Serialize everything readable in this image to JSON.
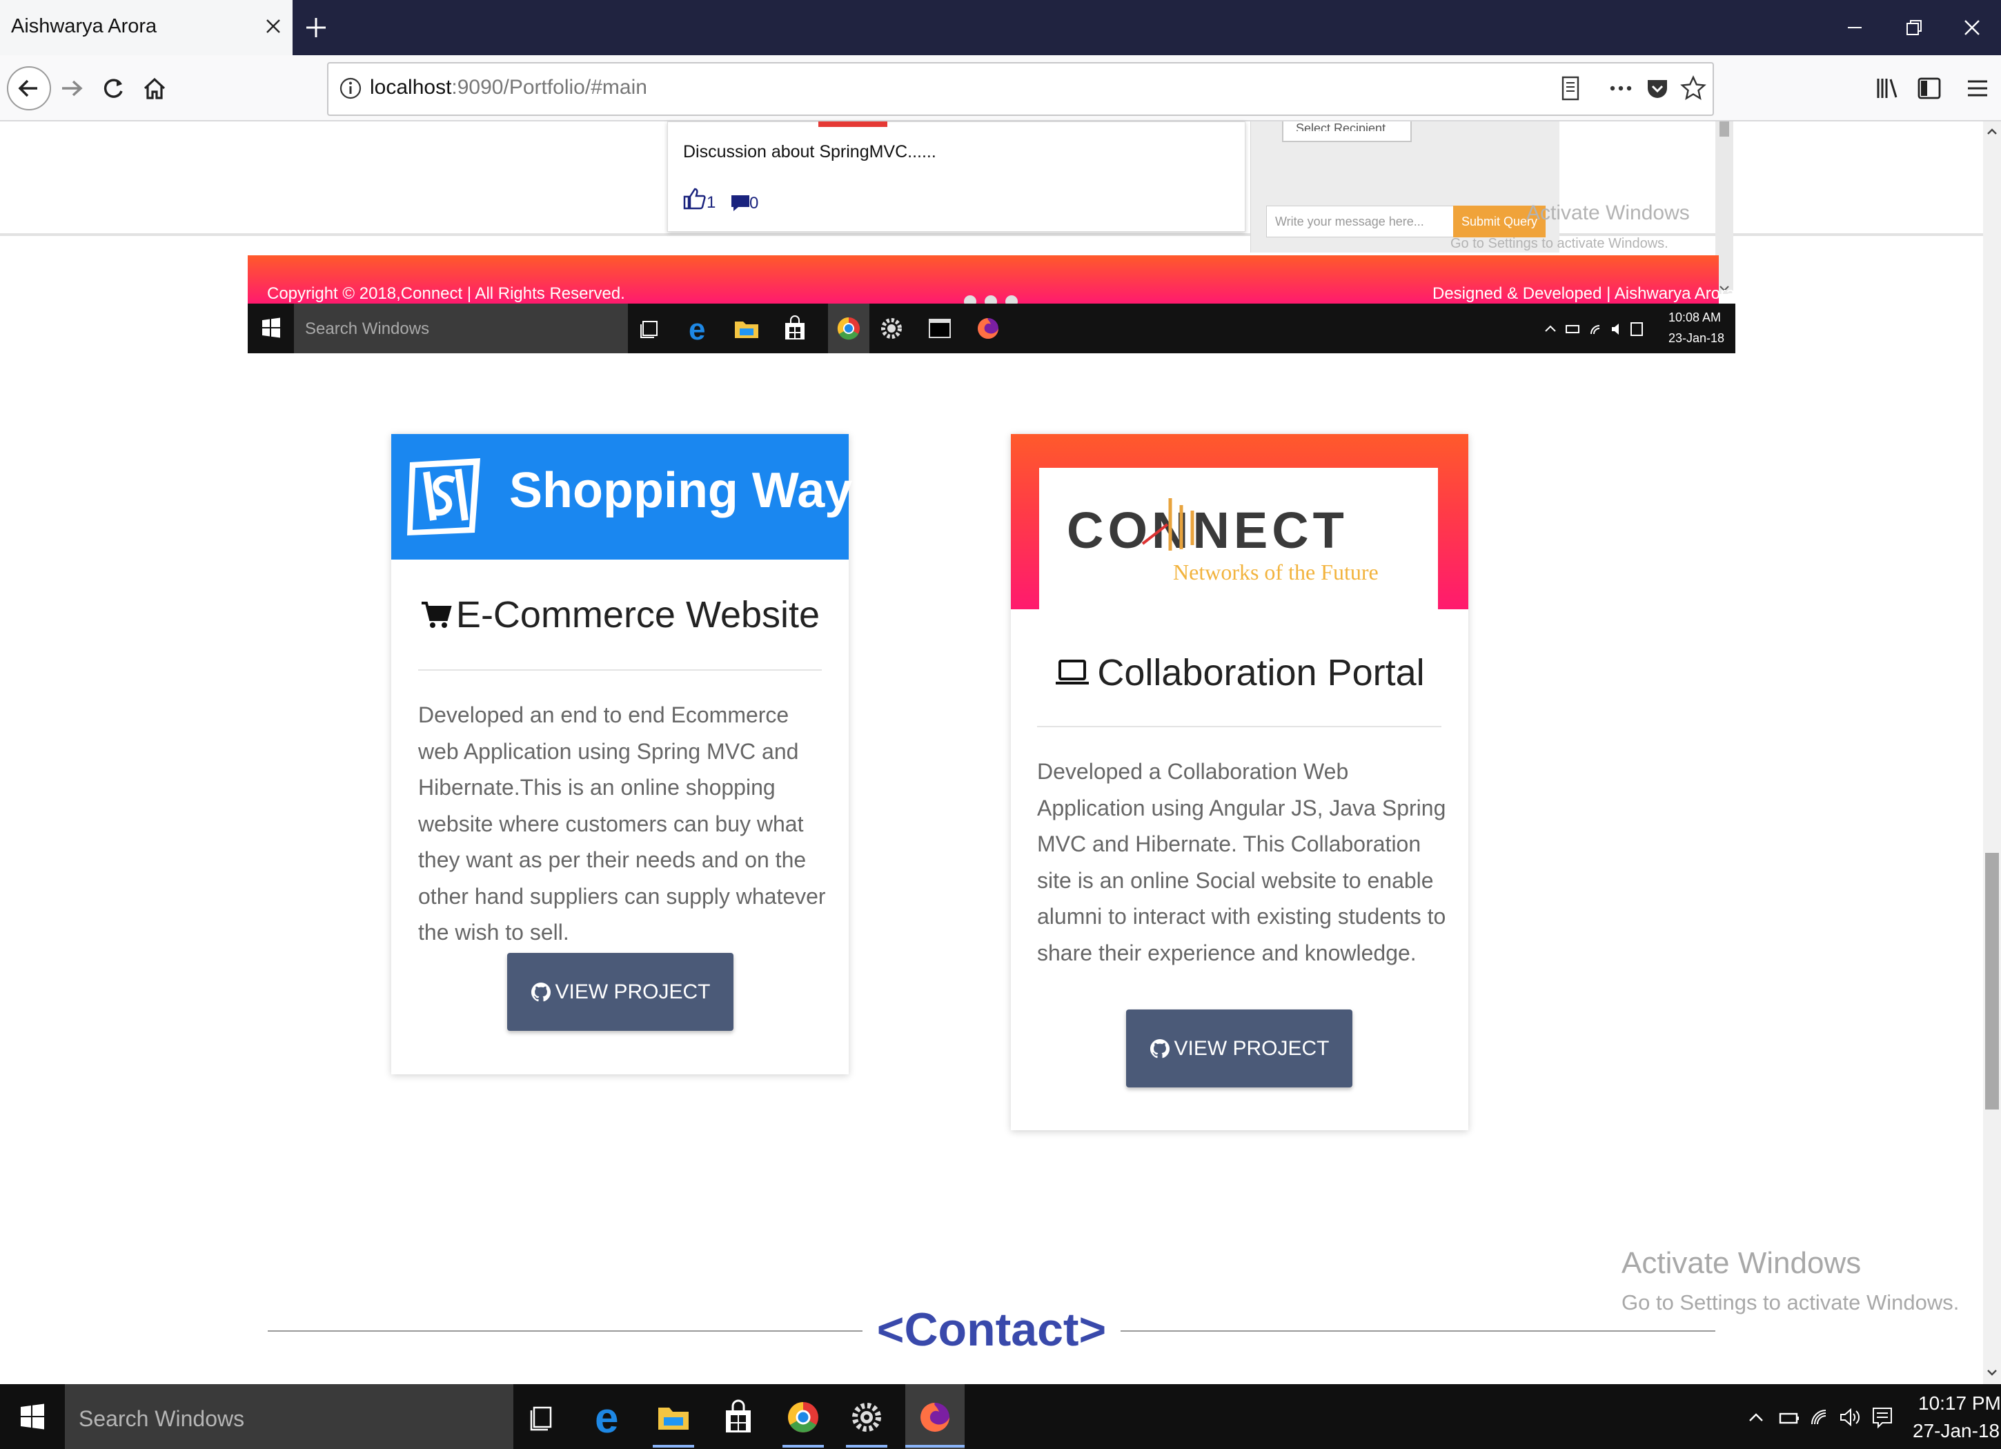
{
  "browser": {
    "tab_title": "Aishwarya Arora",
    "url_host": "localhost",
    "url_rest": ":9090/Portfolio/#main"
  },
  "embedded_screenshot": {
    "post_text": "Discussion about SpringMVC......",
    "like_count": "1",
    "comment_count": "0",
    "select_placeholder": "Select Recipient",
    "message_placeholder": "Write your message here...",
    "submit_label": "Submit Query",
    "activate_title": "Activate Windows",
    "activate_sub": "Go to Settings to activate Windows.",
    "footer_left": "Copyright © 2018,Connect | All Rights Reserved.",
    "footer_right": "Designed & Developed | Aishwarya Arora",
    "taskbar_search": "Search Windows",
    "clock_time": "10:08 AM",
    "clock_date": "23-Jan-18"
  },
  "projects": [
    {
      "brand": "Shopping Way!!!",
      "title": "E-Commerce Website",
      "description": "Developed an end to end Ecommerce web Application using Spring MVC and Hibernate.This is an online shopping website where customers can buy what they want as per their needs and on the other hand suppliers can supply whatever the wish to sell.",
      "button": "VIEW PROJECT"
    },
    {
      "brand": "CONNECT",
      "tagline": "Networks of the Future",
      "title": "Collaboration Portal",
      "description": "Developed a Collaboration Web Application using Angular JS, Java Spring MVC and Hibernate. This Collaboration site is an online Social website to enable alumni to interact with existing students to share their experience and knowledge.",
      "button": "VIEW PROJECT"
    }
  ],
  "watermark": {
    "title": "Activate Windows",
    "subtitle": "Go to Settings to activate Windows."
  },
  "contact_heading": "<Contact>",
  "taskbar": {
    "search_placeholder": "Search Windows",
    "time": "10:17 PM",
    "date": "27-Jan-18"
  },
  "icons": [
    "close-icon",
    "plus-icon",
    "minimize-icon",
    "restore-icon",
    "back-arrow-icon",
    "forward-arrow-icon",
    "reload-icon",
    "home-icon",
    "info-icon",
    "reader-view-icon",
    "more-actions-icon",
    "pocket-icon",
    "star-icon",
    "library-icon",
    "sidebar-icon",
    "hamburger-menu-icon",
    "cart-icon",
    "laptop-icon",
    "github-icon",
    "windows-logo-icon",
    "edge-icon",
    "file-explorer-icon",
    "store-icon",
    "chrome-icon",
    "settings-gear-icon",
    "firefox-icon"
  ],
  "colors": {
    "card1_banner": "#1a87f0",
    "card2_banner_top": "#ff5a2b",
    "card2_banner_bottom": "#ff1a6e",
    "button": "#4b5a78",
    "contact_heading": "#3949ab",
    "browser_chrome": "#202340"
  }
}
